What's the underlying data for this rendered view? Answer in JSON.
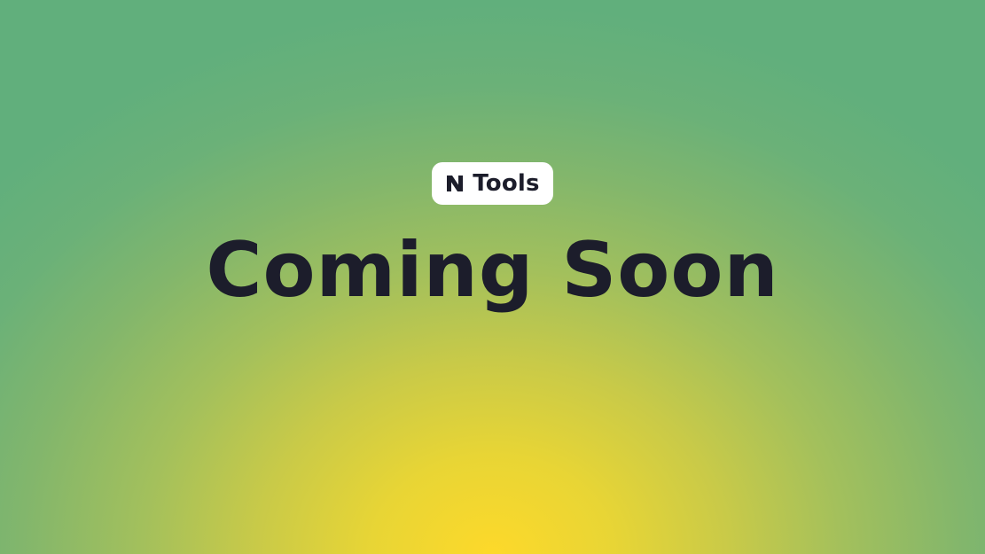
{
  "badge": {
    "logo_icon": "n-logo-icon",
    "label": "Tools"
  },
  "headline": "Coming Soon",
  "colors": {
    "text": "#1c1d2b",
    "badge_bg": "#ffffff",
    "gradient_center": "#fdd92a",
    "gradient_edge": "#61af7c"
  }
}
